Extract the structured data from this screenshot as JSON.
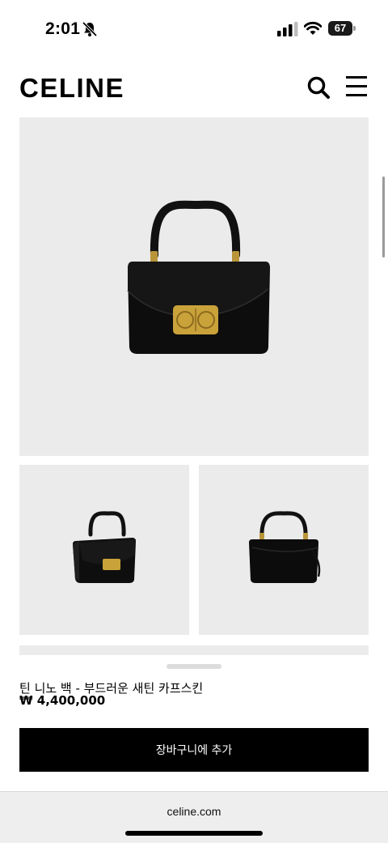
{
  "status_bar": {
    "time": "2:01",
    "battery": "67"
  },
  "header": {
    "logo": "CELINE"
  },
  "product": {
    "name": "틴 니노 백 - 부드러운 새틴 카프스킨",
    "price": "₩ 4,400,000",
    "add_to_cart_label": "장바구니에 추가"
  },
  "browser": {
    "url": "celine.com"
  },
  "icons": {
    "search": "search-icon",
    "menu": "menu-icon",
    "bell": "bell-slash-icon",
    "signal": "signal-icon",
    "wifi": "wifi-icon"
  },
  "colors": {
    "accent": "#000000",
    "image_bg": "#ebebeb",
    "gold": "#c9a23a"
  }
}
